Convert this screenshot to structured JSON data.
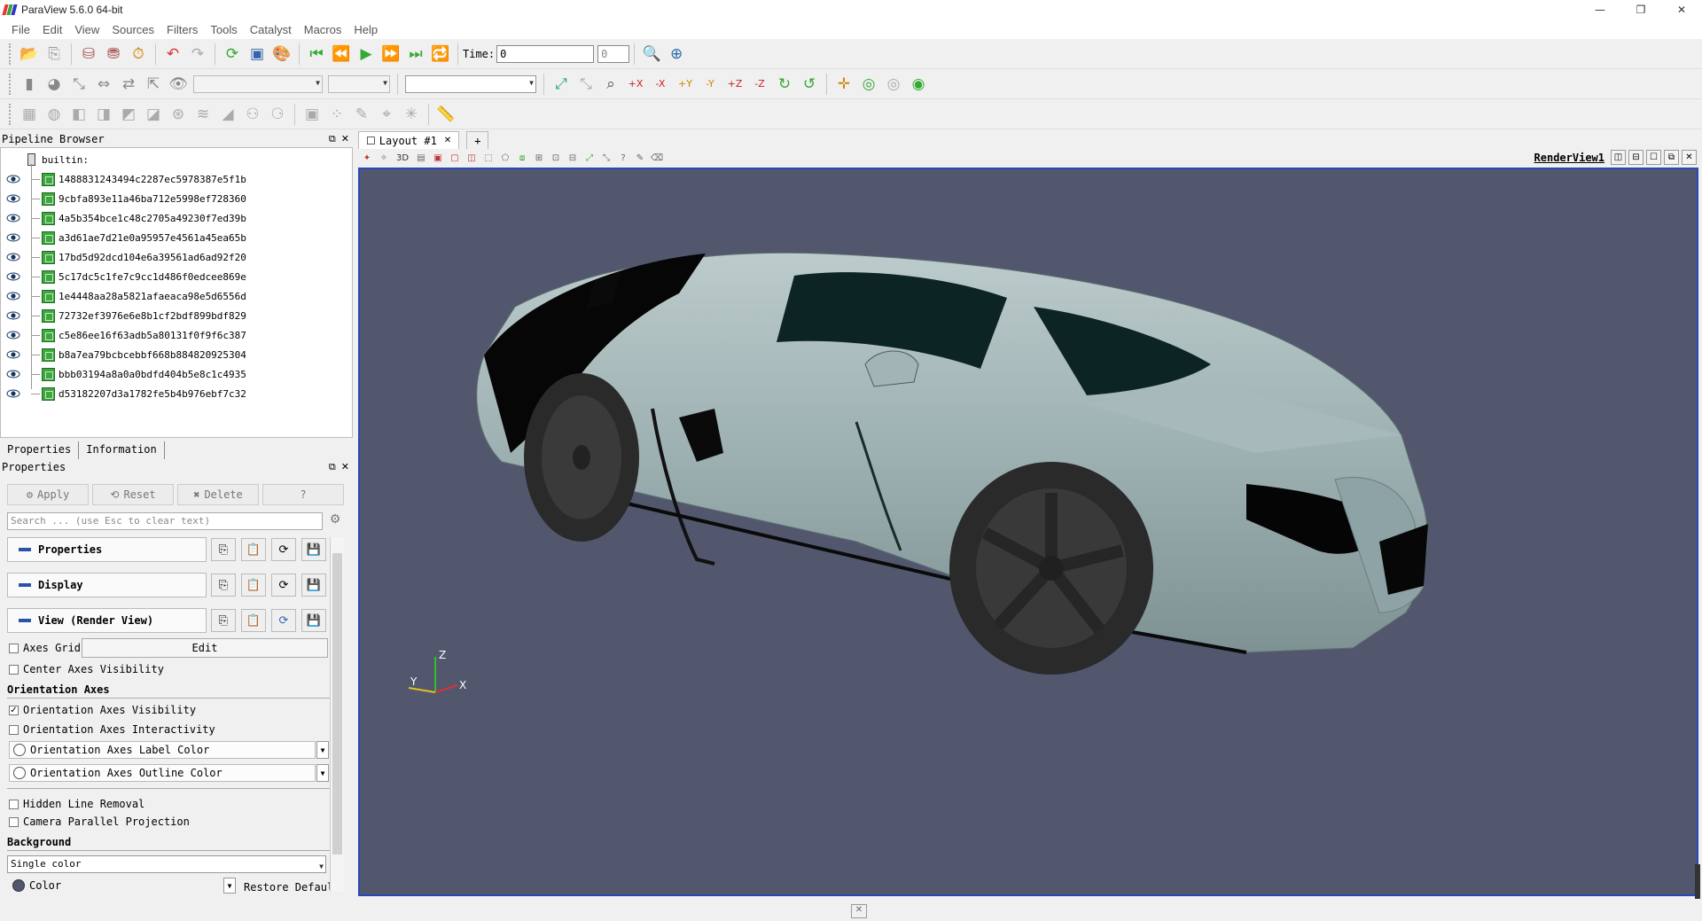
{
  "window": {
    "title": "ParaView 5.6.0 64-bit",
    "controls": [
      "—",
      "❐",
      "✕"
    ]
  },
  "menu": [
    "File",
    "Edit",
    "View",
    "Sources",
    "Filters",
    "Tools",
    "Catalyst",
    "Macros",
    "Help"
  ],
  "toolbar1": {
    "time_label": "Time:",
    "time_value": "0",
    "time_step": "0"
  },
  "pipeline": {
    "title": "Pipeline Browser",
    "root": "builtin:",
    "items": [
      "1488831243494c2287ec5978387e5f1b",
      "9cbfa893e11a46ba712e5998ef728360",
      "4a5b354bce1c48c2705a49230f7ed39b",
      "a3d61ae7d21e0a95957e4561a45ea65b",
      "17bd5d92dcd104e6a39561ad6ad92f20",
      "5c17dc5c1fe7c9cc1d486f0edcee869e",
      "1e4448aa28a5821afaeaca98e5d6556d",
      "72732ef3976e6e8b1cf2bdf899bdf829",
      "c5e86ee16f63adb5a80131f0f9f6c387",
      "b8a7ea79bcbcebbf668b884820925304",
      "bbb03194a8a0a0bdfd404b5e8c1c4935",
      "d53182207d3a1782fe5b4b976ebf7c32"
    ]
  },
  "tabs": [
    "Properties",
    "Information"
  ],
  "properties": {
    "title": "Properties",
    "apply": "Apply",
    "reset": "Reset",
    "delete": "Delete",
    "help": "?",
    "search_placeholder": "Search ... (use Esc to clear text)",
    "sections": [
      "Properties",
      "Display",
      "View (Render View)"
    ],
    "axes_grid": "Axes Grid",
    "edit": "Edit",
    "center_axes": "Center Axes Visibility",
    "orientation_header": "Orientation Axes",
    "orient_vis": "Orientation Axes Visibility",
    "orient_inter": "Orientation Axes Interactivity",
    "orient_label_color": "Orientation Axes Label Color",
    "orient_outline_color": "Orientation Axes Outline Color",
    "hidden_line": "Hidden Line Removal",
    "camera_parallel": "Camera Parallel Projection",
    "background_header": "Background",
    "background_mode": "Single color",
    "color": "Color",
    "restore_default": "Restore Default"
  },
  "layout": {
    "tab": "Layout #1",
    "plus": "+",
    "view_label": "RenderView1",
    "mode_3d": "3D"
  },
  "axes": {
    "z": "Z",
    "y": "Y",
    "x": "X"
  },
  "colors": {
    "background": "#52576e",
    "car_body": "#9fb3b5",
    "accent": "#2848b6"
  }
}
